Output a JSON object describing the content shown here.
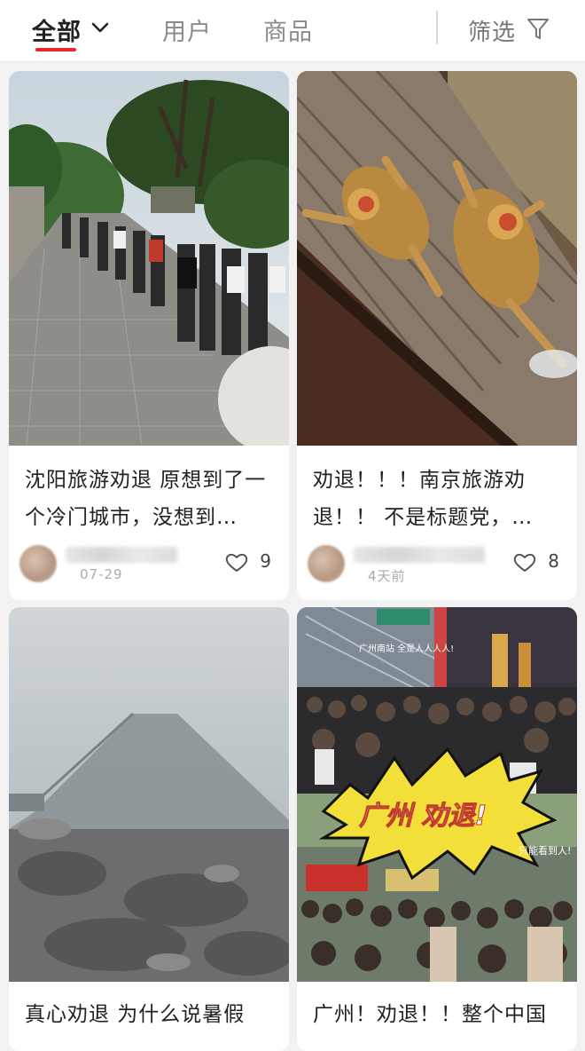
{
  "tabs": [
    {
      "label": "全部",
      "active": true
    },
    {
      "label": "用户",
      "active": false
    },
    {
      "label": "商品",
      "active": false
    }
  ],
  "filter": {
    "label": "筛选",
    "icon": "funnel-icon"
  },
  "accent_color": "#e8272c",
  "cards": [
    {
      "image": "tourist crowd at Shenyang scenic spot",
      "title": "沈阳旅游劝退 原想到了一个冷门城市，没想到…",
      "date": "07-29",
      "likes": "9"
    },
    {
      "image": "golden monkeys on a wooden deck",
      "title": "劝退！！！南京旅游劝退！！ 不是标题党，…",
      "date": "4天前",
      "likes": "8"
    },
    {
      "image": "foggy mountain peak",
      "title": "真心劝退 为什么说暑假"
    },
    {
      "image": "Guangzhou crowd collage",
      "title": "广州！劝退！！整个中国",
      "sticker_text": "广州 劝退!",
      "caption": "只能看到人!",
      "overlay_text": "广州南站 全是人人人人!"
    }
  ]
}
